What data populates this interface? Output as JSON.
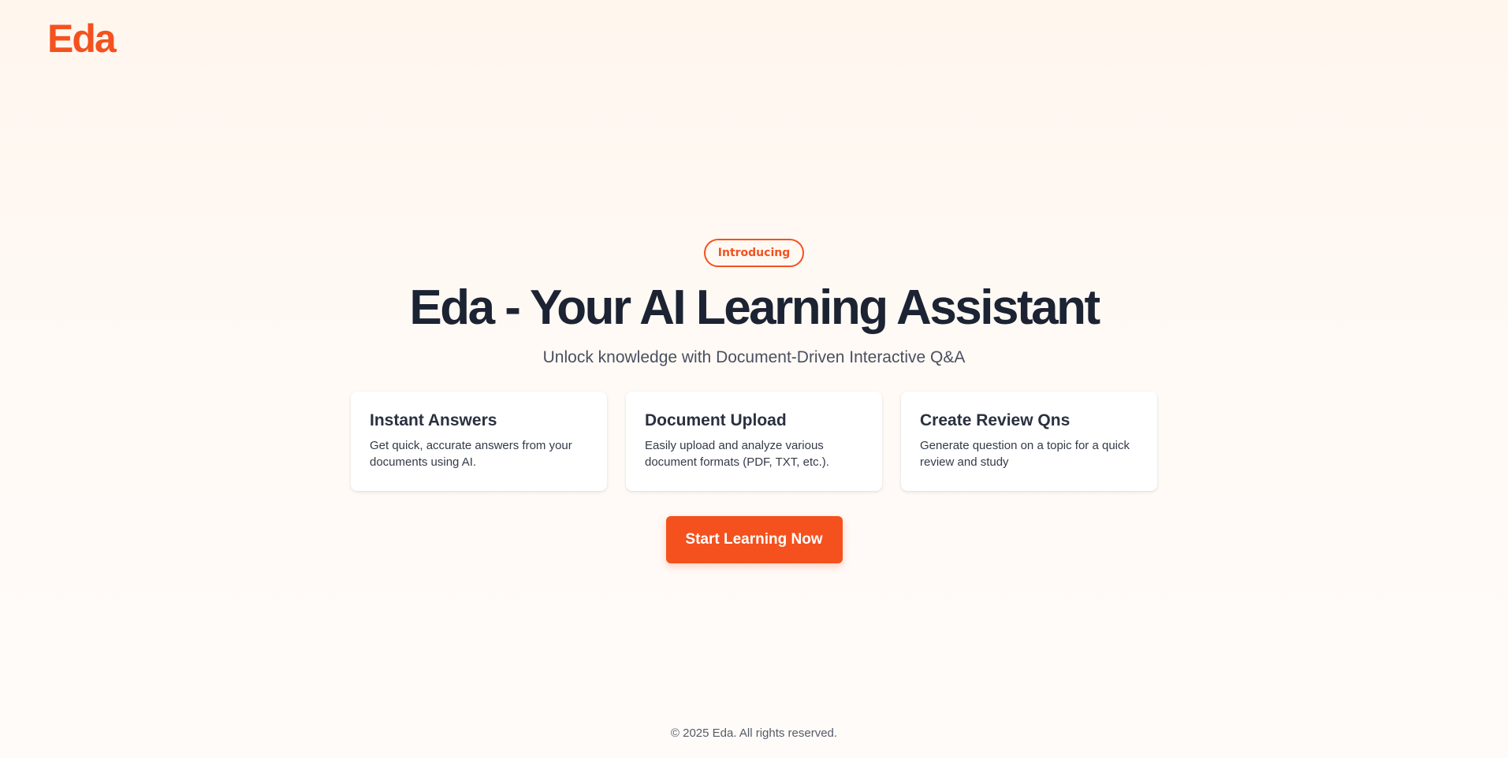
{
  "header": {
    "logo_text": "Eda"
  },
  "hero": {
    "badge": "Introducing",
    "title": "Eda - Your AI Learning Assistant",
    "subtitle": "Unlock knowledge with Document-Driven Interactive Q&A"
  },
  "features": [
    {
      "title": "Instant Answers",
      "description": "Get quick, accurate answers from your documents using AI."
    },
    {
      "title": "Document Upload",
      "description": "Easily upload and analyze various document formats (PDF, TXT, etc.)."
    },
    {
      "title": "Create Review Qns",
      "description": "Generate question on a topic for a quick review and study"
    }
  ],
  "cta": {
    "label": "Start Learning Now"
  },
  "footer": {
    "copyright": "© 2025 Eda. All rights reserved."
  },
  "colors": {
    "accent": "#f4511e",
    "heading": "#1c2333",
    "background": "#fff6ee"
  }
}
